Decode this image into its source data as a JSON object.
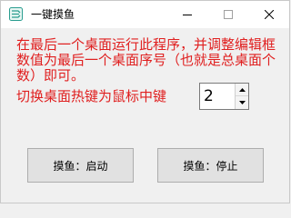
{
  "window": {
    "title": "一键摸鱼",
    "app_icon": "fish-app-icon"
  },
  "titlebar_buttons": {
    "minimize_icon": "minimize-icon",
    "maximize_icon": "maximize-icon",
    "close_icon": "close-icon"
  },
  "main": {
    "instruction": "在最后一个桌面运行此程序，并调整编辑框数值为最后一个桌面序号（也就是总桌面个数）即可。",
    "hotkey_label": "切换桌面热键为鼠标中键",
    "desktop_number": "2",
    "spin_up_icon": "spin-up-arrow-icon",
    "spin_down_icon": "spin-down-arrow-icon",
    "start_button": "摸鱼：启动",
    "stop_button": "摸鱼：停止"
  },
  "colors": {
    "instruction_text": "#e02020",
    "window_bg": "#f0f0f0",
    "titlebar_bg": "#ffffff",
    "icon_accent": "#2a9d8f"
  }
}
